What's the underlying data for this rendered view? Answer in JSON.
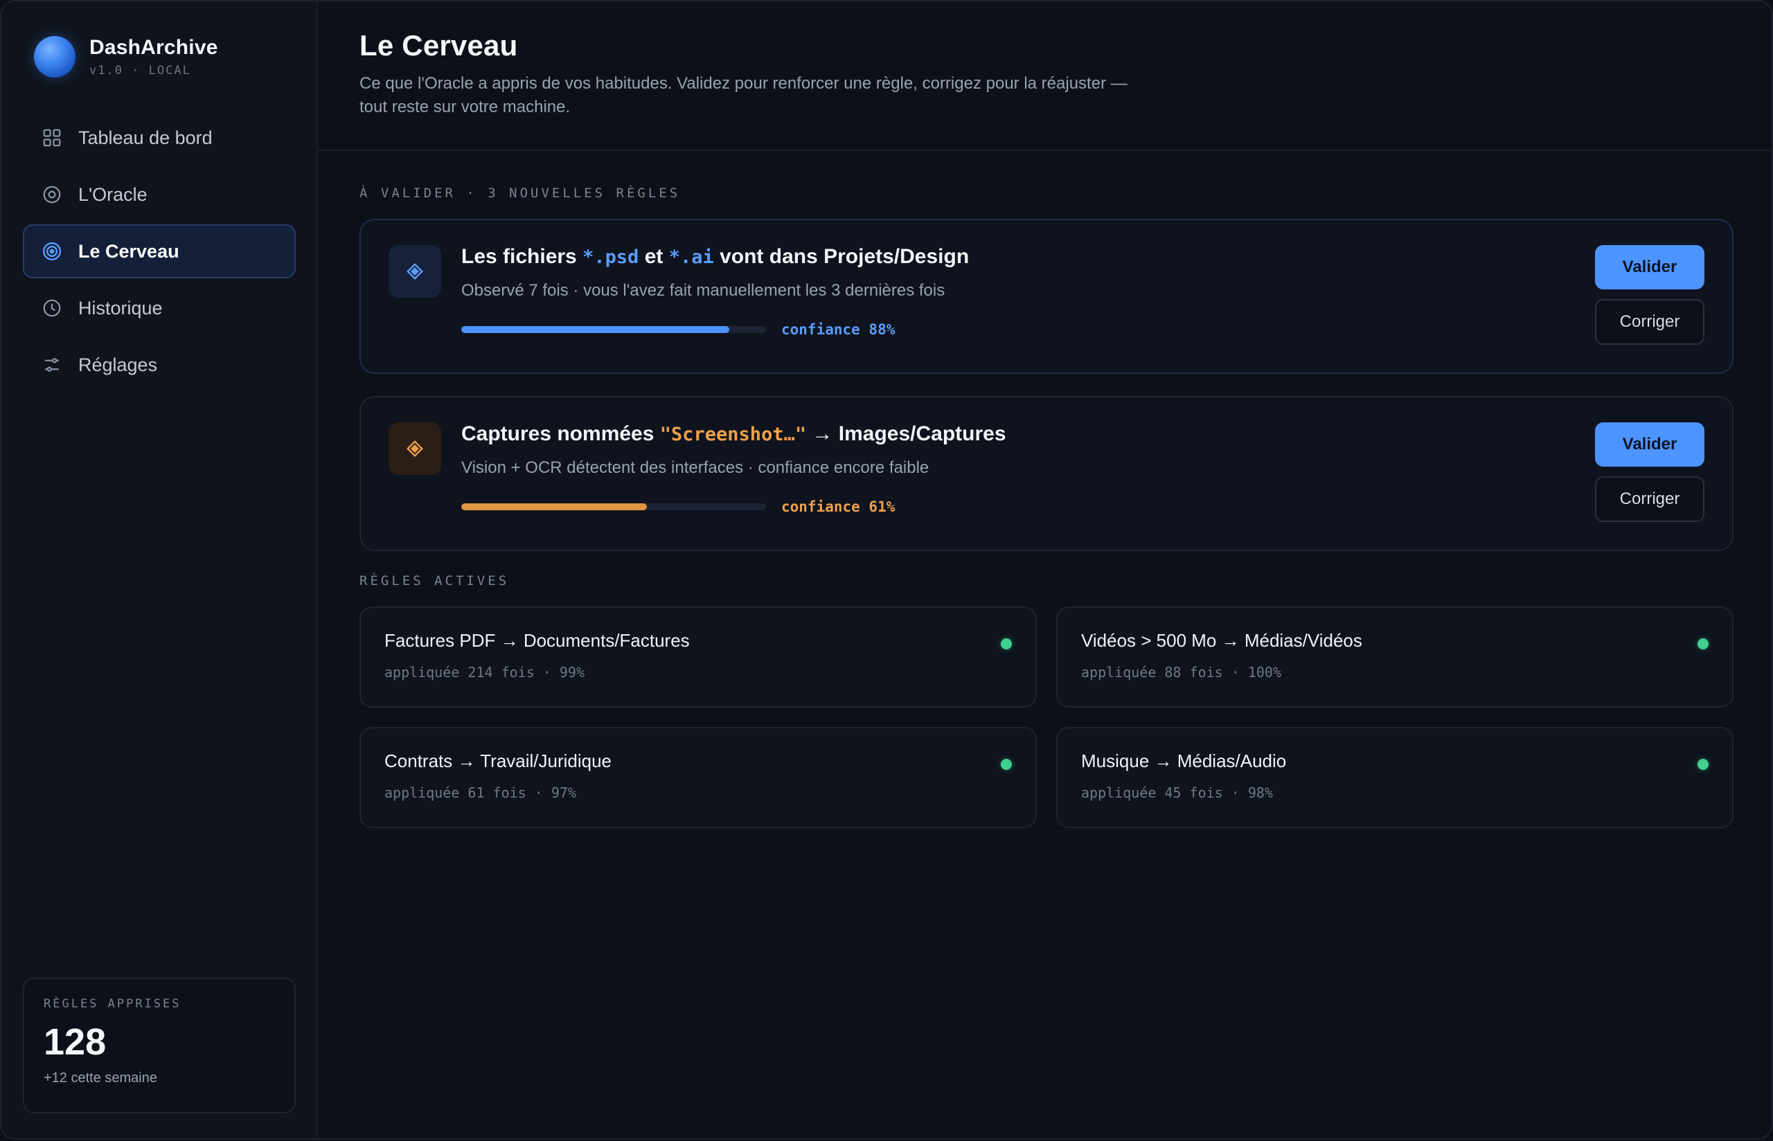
{
  "app": {
    "name": "DashArchive",
    "version": "v1.0 · LOCAL"
  },
  "sidebar": {
    "items": [
      {
        "label": "Tableau de bord",
        "icon": "grid-icon"
      },
      {
        "label": "L'Oracle",
        "icon": "oracle-icon"
      },
      {
        "label": "Le Cerveau",
        "icon": "target-icon",
        "active": true
      },
      {
        "label": "Historique",
        "icon": "clock-icon"
      },
      {
        "label": "Réglages",
        "icon": "sliders-icon"
      }
    ],
    "stats": {
      "label": "RÈGLES APPRISES",
      "value": "128",
      "delta": "+12 cette semaine"
    }
  },
  "header": {
    "title": "Le Cerveau",
    "description": "Ce que l'Oracle a appris de vos habitudes. Validez pour renforcer une règle, corrigez pour la réajuster — tout reste sur votre machine."
  },
  "pending": {
    "section_label": "À VALIDER · 3 NOUVELLES RÈGLES",
    "cards": [
      {
        "title_pre": "Les fichiers ",
        "code1": "*.psd",
        "title_mid": " et ",
        "code2": "*.ai",
        "title_post": " vont dans Projets/Design",
        "subtitle": "Observé 7 fois · vous l'avez fait manuellement les 3 dernières fois",
        "confidence": 0.88,
        "confidence_label": "confiance 88%",
        "accent": "#4c94ff",
        "icon": "diamond-icon",
        "validate_label": "Valider",
        "correct_label": "Corriger"
      },
      {
        "title_pre": "Captures nommées ",
        "code1": "\"Screenshot…\"",
        "title_post": " → Images/Captures",
        "subtitle": "Vision + OCR détectent des interfaces · confiance encore faible",
        "confidence": 0.61,
        "confidence_label": "confiance 61%",
        "accent": "#e0953f",
        "icon": "diamond-icon",
        "validate_label": "Valider",
        "correct_label": "Corriger"
      }
    ]
  },
  "active": {
    "section_label": "RÈGLES ACTIVES",
    "rules": [
      {
        "title": "Factures PDF → Documents/Factures",
        "meta": "appliquée 214 fois · 99%"
      },
      {
        "title": "Vidéos > 500 Mo → Médias/Vidéos",
        "meta": "appliquée 88 fois · 100%"
      },
      {
        "title": "Contrats → Travail/Juridique",
        "meta": "appliquée 61 fois · 97%"
      },
      {
        "title": "Musique → Médias/Audio",
        "meta": "appliquée 45 fois · 98%"
      }
    ],
    "status_color": "#3ecf8e"
  },
  "colors": {
    "background": "#0c1018",
    "accent_blue": "#4c94ff",
    "accent_orange": "#e0953f",
    "active_green": "#3ecf8e"
  }
}
